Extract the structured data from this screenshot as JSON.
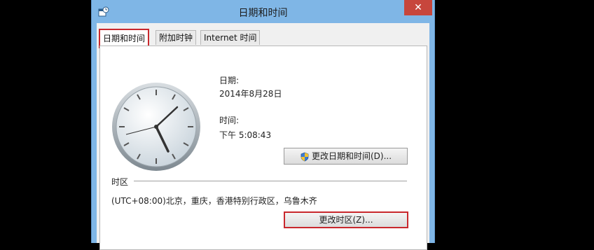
{
  "window": {
    "title": "日期和时间",
    "close_glyph": "✕"
  },
  "tabs": [
    {
      "label": "日期和时间",
      "active": true
    },
    {
      "label": "附加时钟",
      "active": false
    },
    {
      "label": "Internet 时间",
      "active": false
    }
  ],
  "datetime": {
    "date_label": "日期:",
    "date_value": "2014年8月28日",
    "time_label": "时间:",
    "time_value": "下午 5:08:43",
    "change_button": "更改日期和时间(D)..."
  },
  "timezone": {
    "section_label": "时区",
    "value": "(UTC+08:00)北京，重庆，香港特别行政区，乌鲁木齐",
    "change_button": "更改时区(Z)..."
  },
  "icons": {
    "app": "calendar-clock-icon",
    "close": "close-icon",
    "uac": "uac-shield-icon",
    "clock": "analog-clock-icon"
  },
  "colors": {
    "titlebar": "#7fb6e6",
    "close": "#c7463c",
    "highlight": "#c9282d"
  }
}
